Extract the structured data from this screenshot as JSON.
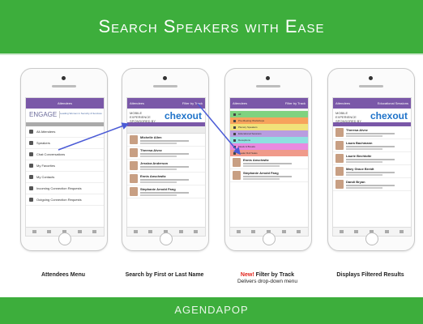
{
  "header": {
    "title": "Search Speakers with Ease"
  },
  "footer": {
    "brand": "AGENDAPOP"
  },
  "colors": {
    "brand_green": "#3dae3c",
    "app_purple": "#7a58a8",
    "arrow_blue": "#4b5bd6",
    "new_red": "#e2231a"
  },
  "phone1": {
    "bar_title": "Attendees",
    "logo_main": "ENGAGE",
    "logo_sub": "Leading Women in Security & Services",
    "menu": [
      {
        "label": "All Attendees",
        "icon": "people-icon"
      },
      {
        "label": "Speakers",
        "icon": "microphone-icon"
      },
      {
        "label": "Chat Conversations",
        "icon": "chat-icon"
      },
      {
        "label": "My Favorites",
        "icon": "star-icon"
      },
      {
        "label": "My Contacts",
        "icon": "contacts-icon"
      },
      {
        "label": "Incoming Connection Requests",
        "icon": "inbox-icon"
      },
      {
        "label": "Outgoing Connection Requests",
        "icon": "outbox-icon"
      }
    ]
  },
  "phone2": {
    "bar_back": "Attendees",
    "bar_title": "Filter by Track",
    "sponsor_text": "MOBILE EXPERIENCE SPONSORED BY",
    "sponsor_logo": "chexout",
    "people": [
      "Michelle Allen",
      "Theresa Alvez",
      "Jessica Anderson",
      "Ennis Anschwitz",
      "Stephanie Arnold Fang"
    ]
  },
  "phone3": {
    "bar_back": "Attendees",
    "bar_title": "Filter by Track",
    "tracks": [
      {
        "label": "All",
        "color": "#7fd27f"
      },
      {
        "label": "Pre-Meeting Workshops",
        "color": "#f7a35c"
      },
      {
        "label": "Plenary Speakers",
        "color": "#f1e27a"
      },
      {
        "label": "Educational Sessions",
        "color": "#b89de0"
      },
      {
        "label": "Receptions",
        "color": "#8ee0e0"
      },
      {
        "label": "Meals & Breaks",
        "color": "#e88ae0"
      },
      {
        "label": "Leader Roll Sales",
        "color": "#f09a8a"
      }
    ],
    "people": [
      "Ennis Anschwitz",
      "Stephanie Arnold Fang"
    ]
  },
  "phone4": {
    "bar_back": "Attendees",
    "bar_title": "Educational Sessions",
    "sponsor_text": "MOBILE EXPERIENCE SPONSORED BY",
    "sponsor_logo": "chexout",
    "people": [
      "Theresa Alvez",
      "Laura Bachmann",
      "Laurie Bechtolte",
      "Mary Grace Breidt",
      "Dandi Bryan"
    ]
  },
  "captions": {
    "c1": "Attendees Menu",
    "c2": "Search by First or Last Name",
    "c3_new": "New!",
    "c3": " Filter by Track",
    "c3_sub": "Delivers drop-down menu",
    "c4": "Displays Filtered Results"
  }
}
